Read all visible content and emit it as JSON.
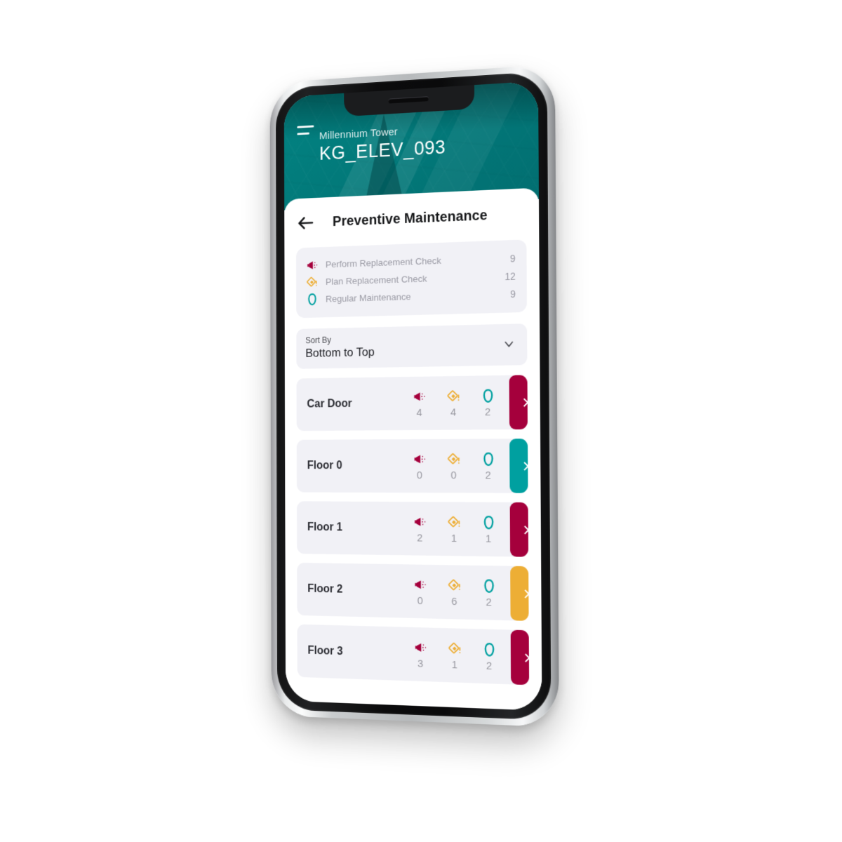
{
  "header": {
    "menu_icon": "hamburger-menu-icon",
    "subtitle": "Millennium Tower",
    "title": "KG_ELEV_093"
  },
  "appbar": {
    "back_icon": "back-arrow-icon",
    "title": "Preventive Maintenance"
  },
  "summary": {
    "items": [
      {
        "icon": "megaphone-icon",
        "label": "Perform Replacement Check",
        "count": "9"
      },
      {
        "icon": "diamond-alert-icon",
        "label": "Plan Replacement Check",
        "count": "12"
      },
      {
        "icon": "maintenance-ring-icon",
        "label": "Regular Maintenance",
        "count": "9"
      }
    ]
  },
  "sort": {
    "label": "Sort By",
    "value": "Bottom to Top",
    "chevron_icon": "chevron-down-icon"
  },
  "list": {
    "rows": [
      {
        "name": "Car Door",
        "perform": "4",
        "plan": "4",
        "regular": "2",
        "accent": "#A5003C"
      },
      {
        "name": "Floor 0",
        "perform": "0",
        "plan": "0",
        "regular": "2",
        "accent": "#00A0A0"
      },
      {
        "name": "Floor 1",
        "perform": "2",
        "plan": "1",
        "regular": "1",
        "accent": "#A5003C"
      },
      {
        "name": "Floor 2",
        "perform": "0",
        "plan": "6",
        "regular": "2",
        "accent": "#EDAE35"
      },
      {
        "name": "Floor 3",
        "perform": "3",
        "plan": "1",
        "regular": "2",
        "accent": "#A5003C"
      }
    ],
    "chevron_icon": "chevron-right-icon"
  },
  "colors": {
    "teal": "#00807F",
    "crimson": "#A5003C",
    "amber": "#EDAE35",
    "card_bg": "#F1F1F6",
    "muted_text": "#9A9AA4"
  }
}
